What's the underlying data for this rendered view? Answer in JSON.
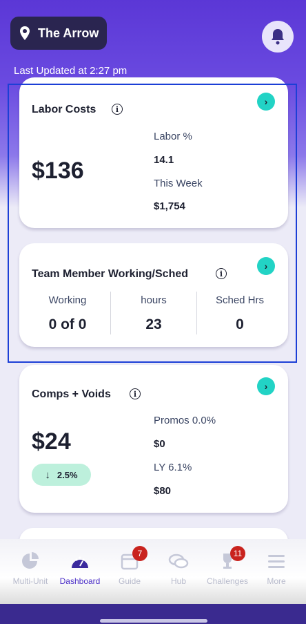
{
  "header": {
    "location_name": "The Arrow",
    "last_updated": "Last Updated at 2:27 pm"
  },
  "labor_card": {
    "title": "Labor Costs",
    "amount": "$136",
    "labor_pct_label": "Labor %",
    "labor_pct_value": "14.1",
    "this_week_label": "This Week",
    "this_week_value": "$1,754"
  },
  "team_card": {
    "title": "Team Member Working/Sched",
    "columns": [
      {
        "label": "Working",
        "value": "0 of 0"
      },
      {
        "label": "hours",
        "value": "23"
      },
      {
        "label": "Sched Hrs",
        "value": "0"
      }
    ]
  },
  "comps_card": {
    "title": "Comps + Voids",
    "amount": "$24",
    "change_badge": "2.5%",
    "promos_label": "Promos 0.0%",
    "promos_value": "$0",
    "ly_label": "LY 6.1%",
    "ly_value": "$80"
  },
  "bottom_nav": {
    "items": [
      {
        "label": "Multi-Unit",
        "icon": "pie-chart-icon"
      },
      {
        "label": "Dashboard",
        "icon": "gauge-icon",
        "active": true
      },
      {
        "label": "Guide",
        "icon": "calendar-icon",
        "badge": "7"
      },
      {
        "label": "Hub",
        "icon": "chat-bubbles-icon"
      },
      {
        "label": "Challenges",
        "icon": "trophy-icon",
        "badge": "11"
      },
      {
        "label": "More",
        "icon": "menu-icon"
      }
    ]
  },
  "colors": {
    "brand_purple": "#5b37d6",
    "accent_teal": "#22d3c5",
    "badge_red": "#c9231e",
    "positive_green": "#bdf0dc"
  }
}
